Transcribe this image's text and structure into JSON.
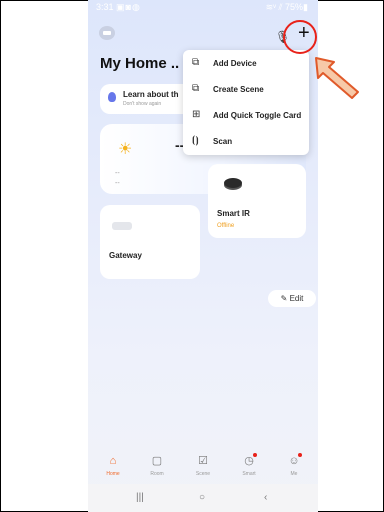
{
  "status_bar": {
    "time": "3:31",
    "icons": "▣◙◍",
    "right": "≋ᵛ ⫽ 75%▮"
  },
  "header": {
    "title": "My Home ..",
    "mic_icon": "mic-icon",
    "add_icon": "+"
  },
  "banner": {
    "title": "Learn about th",
    "subtitle": "Don't show again"
  },
  "weather": {
    "value": "--",
    "line1": "--",
    "line2": "--"
  },
  "devices": [
    {
      "name": "Smart IR",
      "status": "Offline"
    },
    {
      "name": "Gateway",
      "status": ""
    }
  ],
  "edit_label": "Edit",
  "menu": [
    {
      "icon": "add-device-icon",
      "glyph": "⧉",
      "label": "Add Device"
    },
    {
      "icon": "create-scene-icon",
      "glyph": "⧉",
      "label": "Create Scene"
    },
    {
      "icon": "add-card-icon",
      "glyph": "⊞",
      "label": "Add Quick Toggle Card"
    },
    {
      "icon": "scan-icon",
      "glyph": "⦗⦘",
      "label": "Scan"
    }
  ],
  "tabs": [
    {
      "label": "Home",
      "active": true
    },
    {
      "label": "Room",
      "active": false
    },
    {
      "label": "Scene",
      "active": false
    },
    {
      "label": "Smart",
      "active": false
    },
    {
      "label": "Me",
      "active": false
    }
  ],
  "system_nav": {
    "recent": "|||",
    "home": "○",
    "back": "‹"
  },
  "colors": {
    "accent": "#f06a2c",
    "highlight_circle": "#e8221a",
    "offline": "#f0a020"
  }
}
